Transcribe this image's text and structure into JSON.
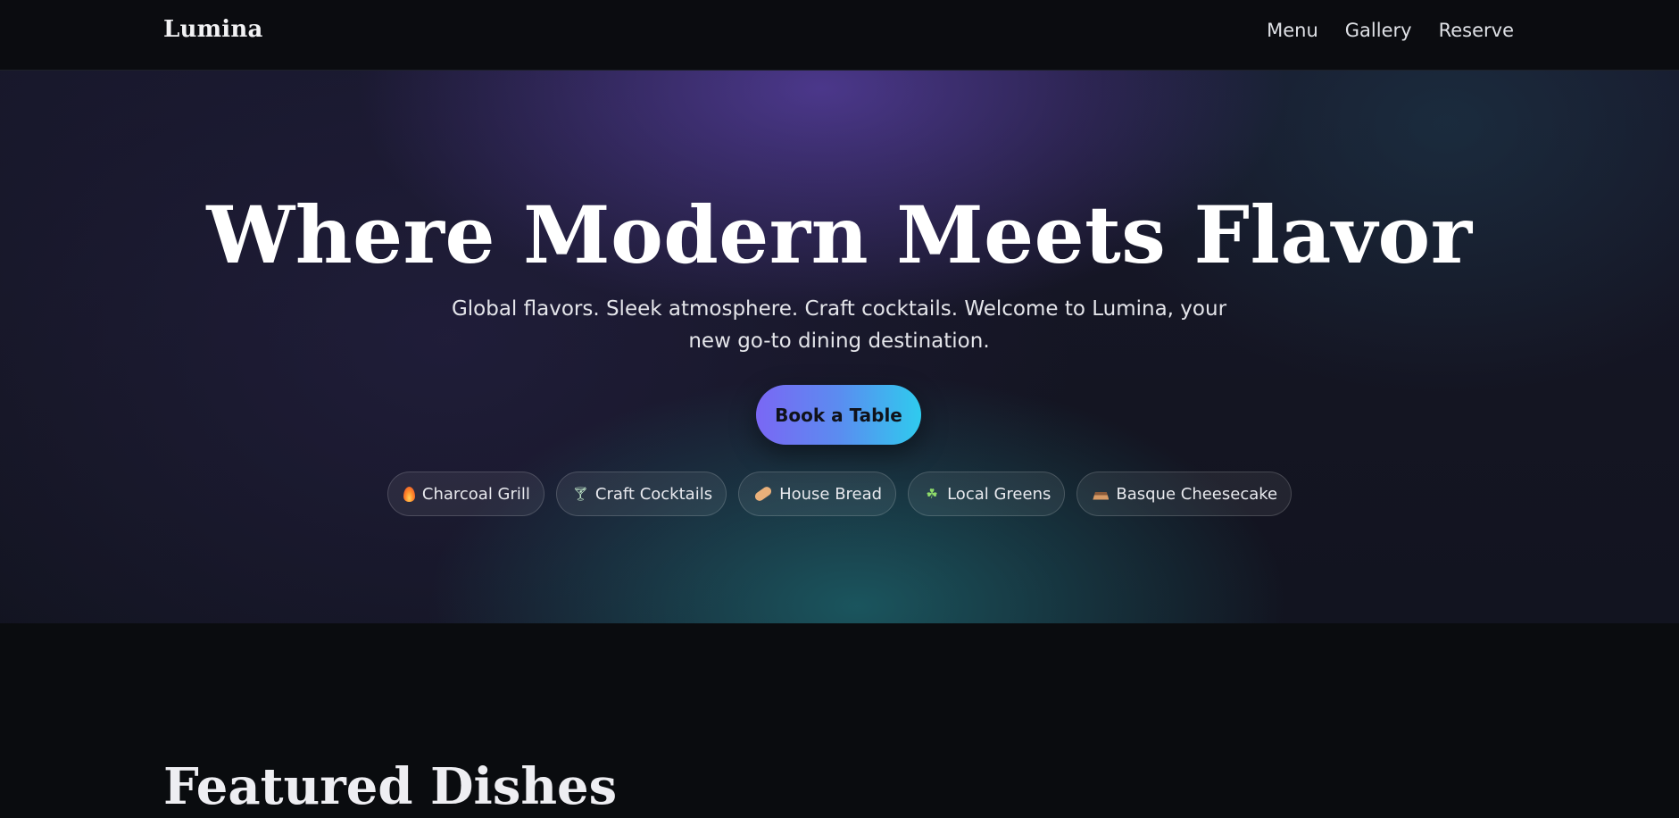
{
  "header": {
    "brand": "Lumina",
    "nav": [
      "Menu",
      "Gallery",
      "Reserve"
    ]
  },
  "hero": {
    "title": "Where Modern Meets Flavor",
    "subtitle": "Global flavors. Sleek atmosphere. Craft cocktails. Welcome to Lumina, your new go-to dining destination.",
    "cta_label": "Book a Table",
    "chips": [
      {
        "label": "Charcoal Grill",
        "icon": "fire-icon"
      },
      {
        "label": "Craft Cocktails",
        "icon": "cocktail-icon"
      },
      {
        "label": "House Bread",
        "icon": "bread-icon"
      },
      {
        "label": "Local Greens",
        "icon": "leaf-icon"
      },
      {
        "label": "Basque Cheesecake",
        "icon": "cheesecake-icon"
      }
    ]
  },
  "featured": {
    "heading": "Featured Dishes"
  },
  "colors": {
    "background": "#0a0c0f",
    "cta_gradient_start": "#7a67f4",
    "cta_gradient_end": "#2fcbee",
    "hero_glow_purple": "#5c42aa",
    "hero_glow_teal": "#1c6068"
  }
}
